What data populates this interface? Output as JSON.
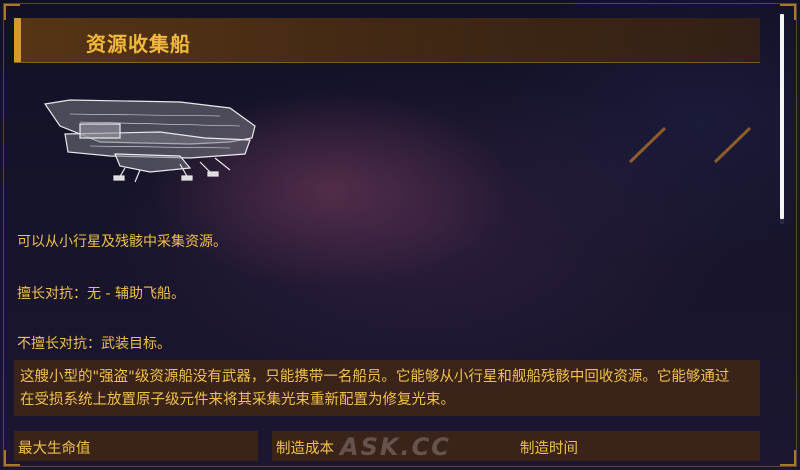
{
  "header": {
    "title": "资源收集船"
  },
  "ship_image": {
    "icon": "mining-ship-icon"
  },
  "descriptions": {
    "line1": "可以从小行星及残骸中采集资源。",
    "line2": "擅长对抗：无 - 辅助飞船。",
    "line3": "不擅长对抗：武装目标。"
  },
  "lore": {
    "text": "这艘小型的\"强盗\"级资源船没有武器，只能携带一名船员。它能够从小行星和舰船残骸中回收资源。它能够通过在受损系统上放置原子级元件来将其采集光束重新配置为修复光束。"
  },
  "stats": {
    "max_hp_label": "最大生命值",
    "build_cost_label": "制造成本",
    "build_time_label": "制造时间"
  },
  "watermark": {
    "text": "ASK.CC"
  },
  "colors": {
    "accent": "#f2b83a",
    "panel": "#5a3714",
    "text": "#f0c04a"
  }
}
